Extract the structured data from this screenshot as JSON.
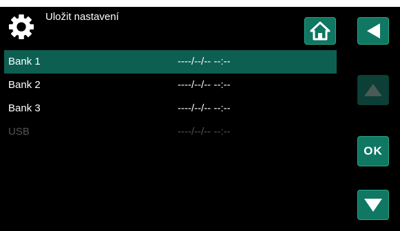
{
  "header": {
    "title": "Uložit nastavení",
    "icon": "gear-icon"
  },
  "buttons": {
    "home_icon": "home-icon",
    "back_icon": "back-arrow-icon",
    "up_icon": "up-arrow-icon",
    "ok_label": "OK",
    "down_icon": "down-arrow-icon"
  },
  "list": {
    "items": [
      {
        "name": "Bank 1",
        "date": "----/--/-- --:--",
        "selected": true,
        "enabled": true
      },
      {
        "name": "Bank 2",
        "date": "----/--/-- --:--",
        "selected": false,
        "enabled": true
      },
      {
        "name": "Bank 3",
        "date": "----/--/-- --:--",
        "selected": false,
        "enabled": true
      },
      {
        "name": "USB",
        "date": "----/--/-- --:--",
        "selected": false,
        "enabled": false
      }
    ]
  },
  "colors": {
    "background": "#000000",
    "accent": "#0f7762",
    "selected_row": "#0d5f52",
    "disabled_text": "#555555"
  }
}
